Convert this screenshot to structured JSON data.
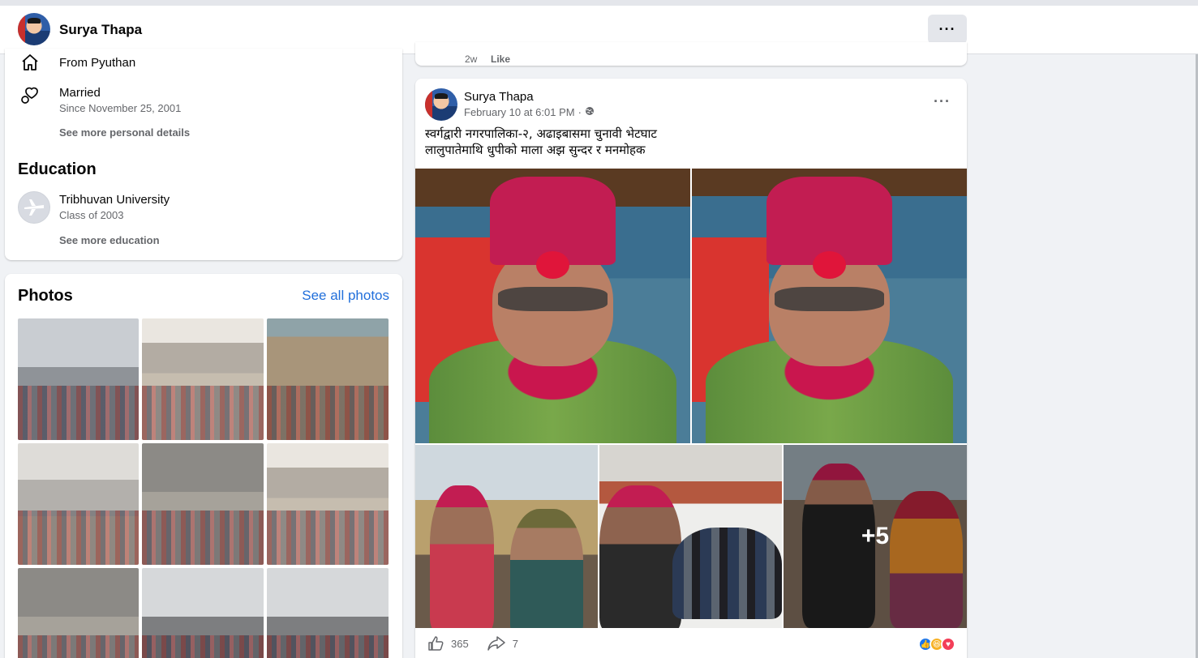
{
  "header": {
    "name": "Surya Thapa",
    "more_label": "···"
  },
  "intro": {
    "hometown": "From Pyuthan",
    "relationship": "Married",
    "relationship_since": "Since November 25, 2001",
    "see_more_personal": "See more personal details",
    "education_title": "Education",
    "school": "Tribhuvan University",
    "school_class": "Class of 2003",
    "see_more_education": "See more education"
  },
  "photos": {
    "title": "Photos",
    "see_all": "See all photos"
  },
  "prev_post": {
    "time": "2w",
    "like": "Like"
  },
  "post": {
    "author": "Surya Thapa",
    "date": "February 10 at 6:01 PM",
    "separator": "·",
    "more_label": "···",
    "text_line1": "स्वर्गद्वारी नगरपालिका-२, अढाइबासमा चुनावी भेटघाट",
    "text_line2": "लालुपातेमाथि धुपीको माला अझ सुन्दर र मनमोहक",
    "more_photos": "+5",
    "likes": "365",
    "shares": "7"
  },
  "colors": {
    "link": "#216fdb",
    "like_reaction": "#1877f2",
    "haha_reaction": "#f7b125",
    "love_reaction": "#f33e58"
  }
}
